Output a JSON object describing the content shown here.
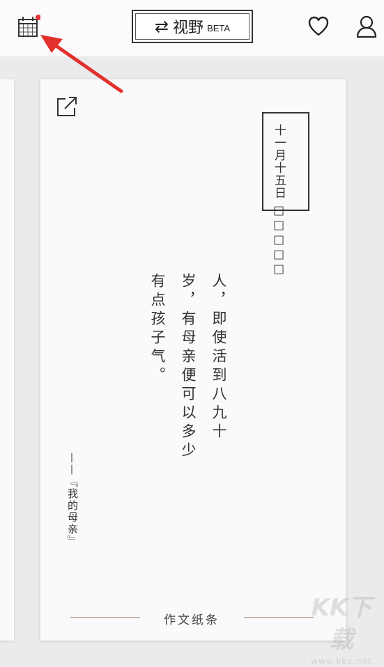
{
  "header": {
    "switch_icon": "⇄",
    "switch_title": "视野",
    "switch_badge": "BETA",
    "icons": [
      "calendar-icon",
      "heart-icon",
      "user-icon"
    ]
  },
  "card": {
    "date": "十一月十五日",
    "date_cols": [
      "十一月十五日",
      "□□□□□"
    ],
    "body": "人，即使活到八九十岁，有母亲便可以多少有点孩子气。",
    "source": "——『我的母亲』",
    "footer_label": "作文纸条",
    "share_icon": "share-external-icon"
  },
  "watermark": {
    "main": "KK下载",
    "url": "www.kkx.net"
  },
  "colors": {
    "annotation_arrow": "#e3302c",
    "notification_dot": "#e0353a",
    "footer_line": "#a0826b"
  }
}
